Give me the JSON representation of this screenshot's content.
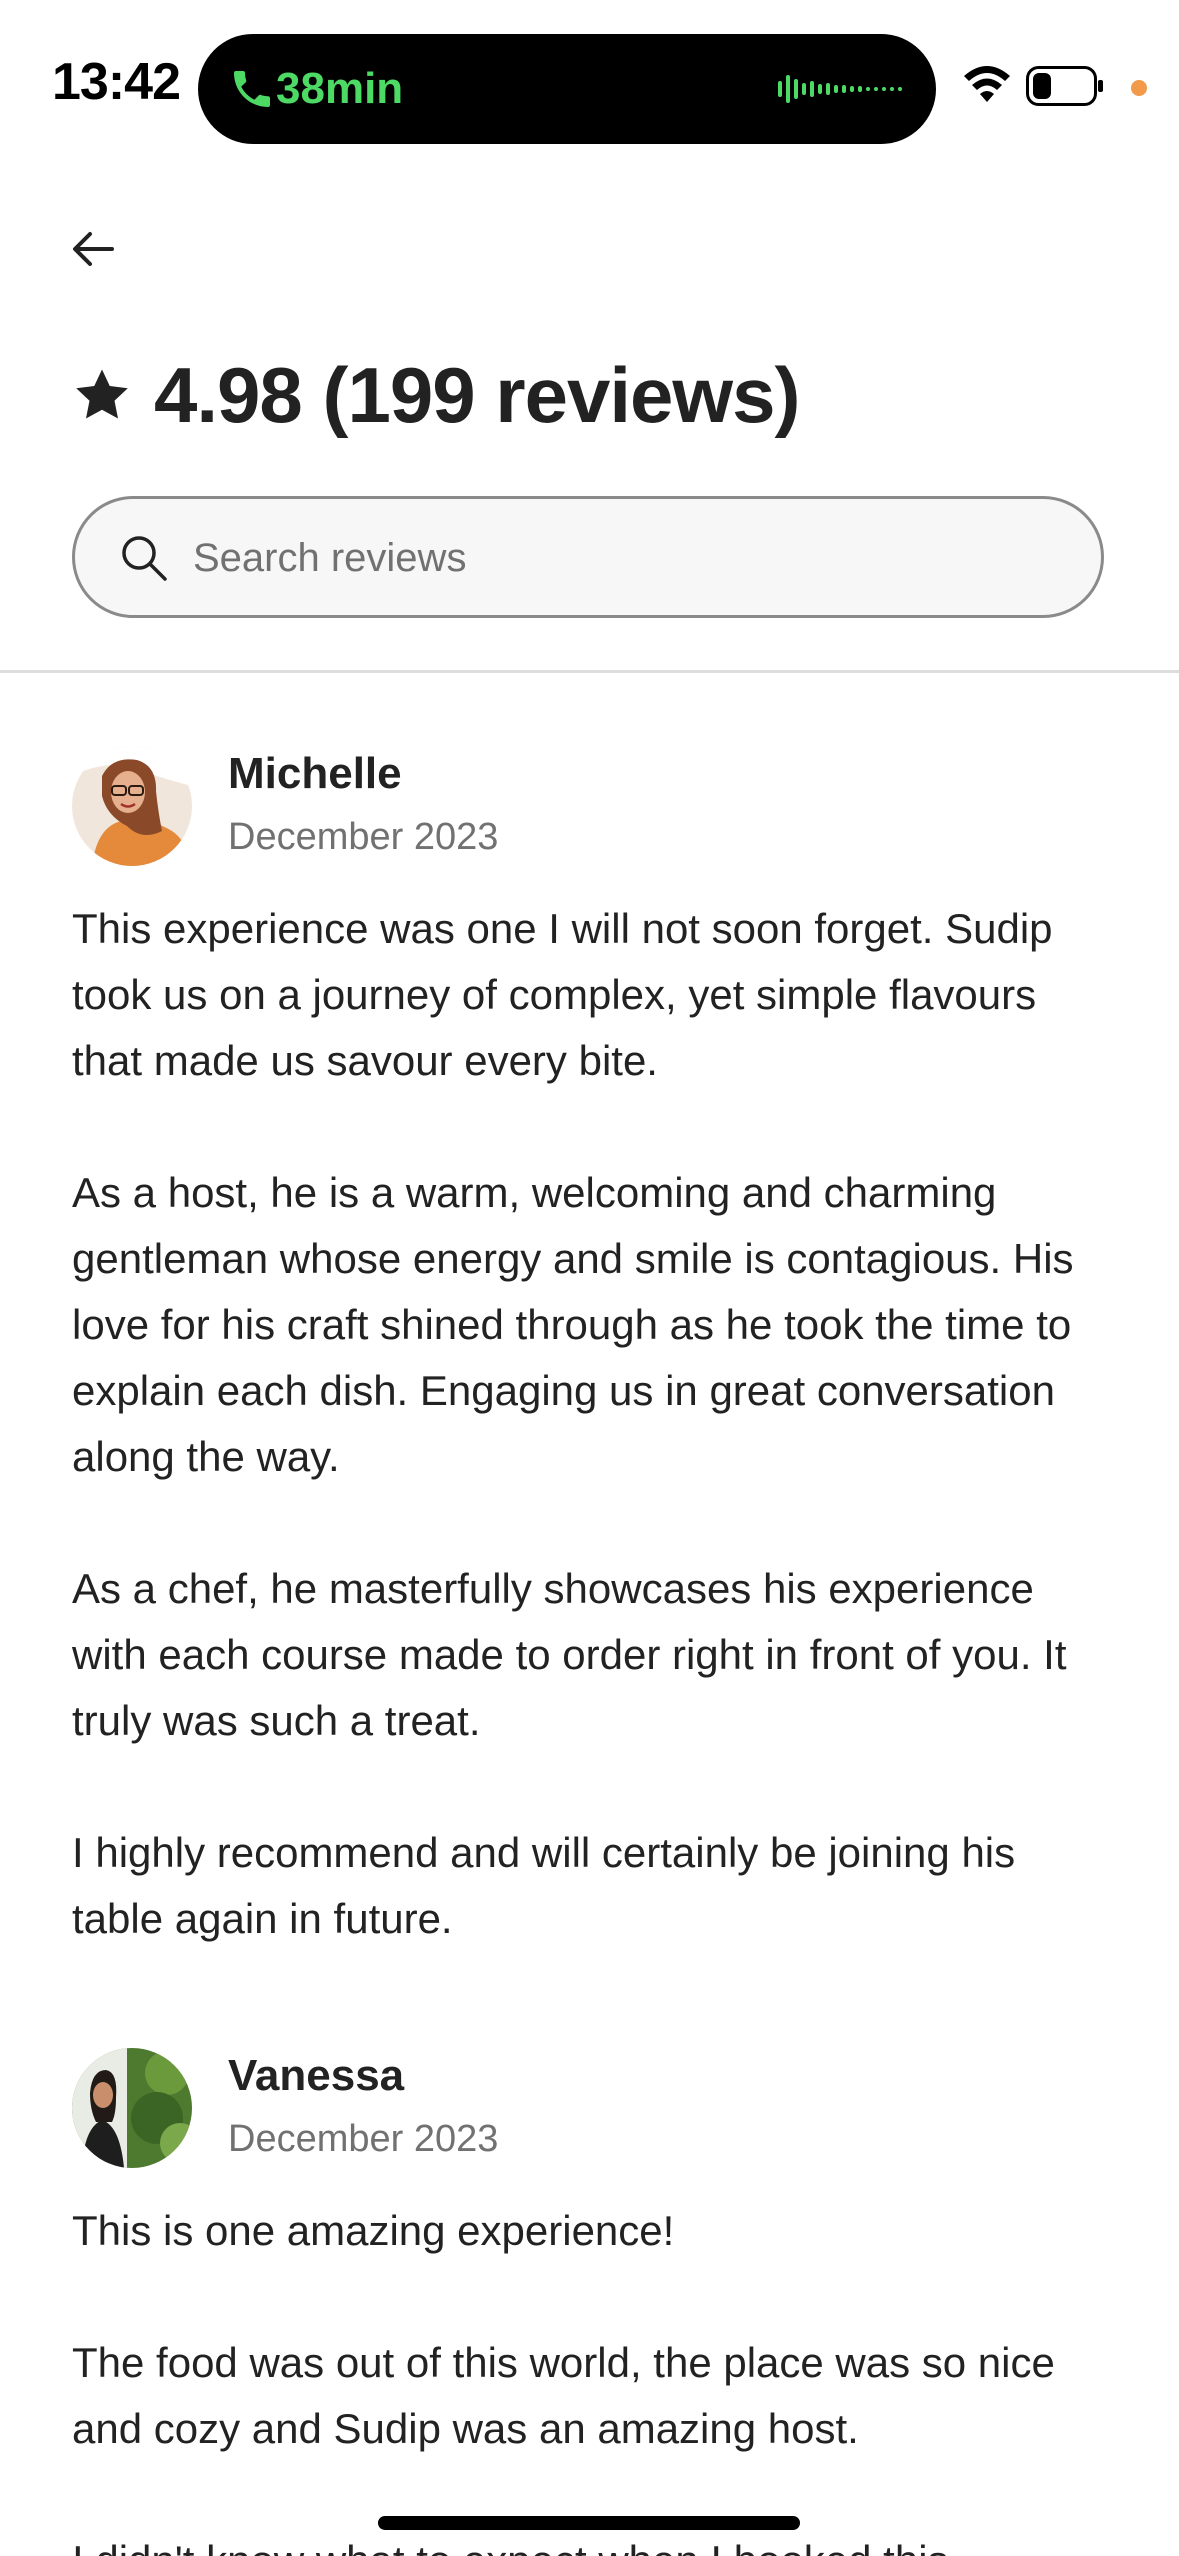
{
  "status_bar": {
    "time": "13:42",
    "call_duration": "38min",
    "call_color": "#4cd964",
    "indicator_dot_color": "#f2994a",
    "icons": [
      "phone-icon",
      "waveform-icon",
      "wifi-icon",
      "battery-icon"
    ]
  },
  "header": {
    "back_icon": "arrow-left-icon",
    "rating": "4.98 (199 reviews)",
    "rating_icon": "star-icon"
  },
  "search": {
    "placeholder": "Search reviews",
    "value": ""
  },
  "reviews": [
    {
      "name": "Michelle",
      "date": "December 2023",
      "paragraphs": [
        "This experience was one I will not soon forget. Sudip took us on a journey of complex, yet simple flavours that made us savour every bite.",
        "As a host, he is a warm, welcoming and charming gentleman whose energy and smile is contagious. His love for his craft shined through as he took the time to explain each dish. Engaging us in great conversation along the way.",
        "As a chef, he masterfully showcases his experience with each course made to order right in front of you. It truly was such a treat.",
        "I highly recommend and will certainly be joining his table again in future."
      ]
    },
    {
      "name": "Vanessa",
      "date": "December 2023",
      "paragraphs": [
        "This is one amazing experience!",
        "The food was out of this world, the place was so nice and cozy and Sudip was an amazing host.",
        "I didn't know what to expect when I booked this experience but I was very pleased that I did."
      ]
    }
  ]
}
